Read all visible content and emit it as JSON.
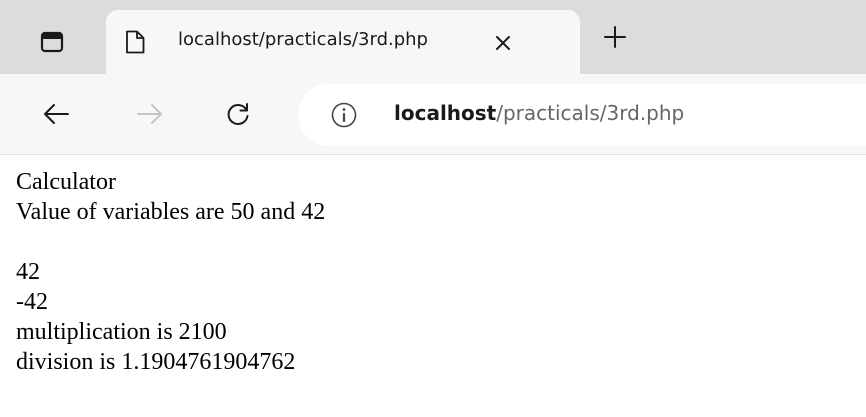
{
  "browser": {
    "tab": {
      "title": "localhost/practicals/3rd.php"
    },
    "address_bar": {
      "host": "localhost",
      "path": "/practicals/3rd.php"
    },
    "icons": {
      "tab_actions": "tab-actions-icon",
      "page": "page-icon",
      "close": "close-icon",
      "new_tab": "plus-icon",
      "back": "back-arrow-icon",
      "forward": "forward-arrow-icon",
      "reload": "reload-icon",
      "info": "info-icon"
    }
  },
  "page": {
    "lines_top": [
      "Calculator",
      "Value of variables are 50 and 42"
    ],
    "lines_bottom": [
      "42",
      "-42",
      "multiplication is 2100",
      "division is 1.1904761904762"
    ]
  }
}
